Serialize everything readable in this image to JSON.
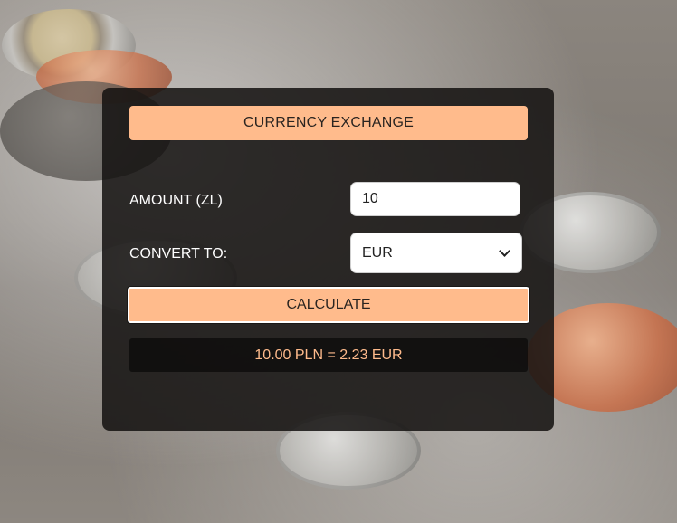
{
  "background": {
    "description_icon": "coins-photo"
  },
  "app": {
    "title": "CURRENCY EXCHANGE",
    "accent_color": "#ffbb8c",
    "panel_color": "#141210"
  },
  "form": {
    "amount_label": "AMOUNT (ZL)",
    "amount_value": "10",
    "convert_label": "CONVERT TO:",
    "currency_selected": "EUR",
    "calculate_label": "CALCULATE"
  },
  "result": {
    "text": "10.00 PLN = 2.23 EUR"
  }
}
